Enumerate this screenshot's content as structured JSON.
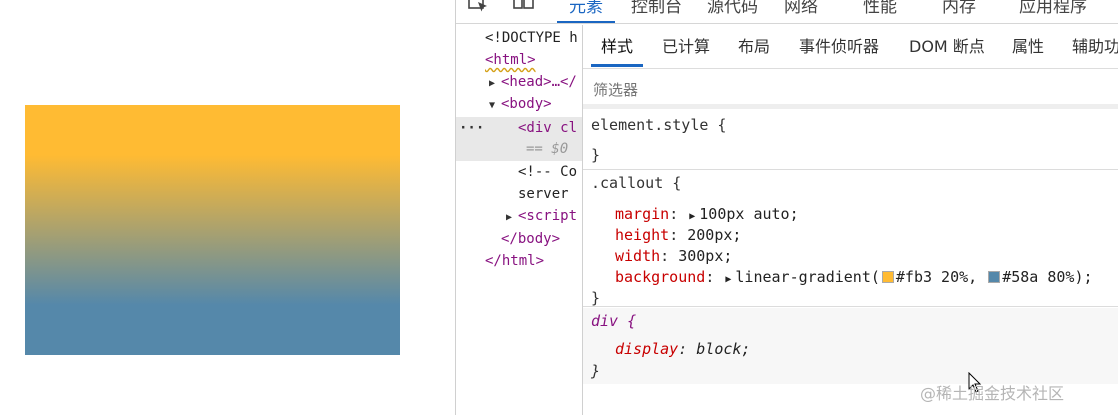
{
  "devtools": {
    "main_tabs": [
      "元素",
      "控制台",
      "源代码",
      "网络",
      "性能",
      "内存",
      "应用程序"
    ],
    "sub_tabs": [
      "样式",
      "已计算",
      "布局",
      "事件侦听器",
      "DOM 断点",
      "属性",
      "辅助功"
    ],
    "filter_placeholder": "筛选器",
    "dom_tree": {
      "doctype": "<!DOCTYPE h",
      "html_open": "<html>",
      "head": "<head>…</",
      "body_open": "<body>",
      "ellipsis": "···",
      "div": "<div cl",
      "eq": "== $0",
      "comment": "<!-- Co",
      "server": "server",
      "script": "<script",
      "body_close": "</body>",
      "html_close": "</html>"
    },
    "rules": {
      "element_style_selector": "element.style {",
      "close_brace": "}",
      "callout_selector": ".callout {",
      "margin_name": "margin",
      "margin_value": "100px auto;",
      "height_name": "height",
      "height_value": "200px;",
      "width_name": "width",
      "width_value": "300px;",
      "background_name": "background",
      "bg_func": "linear-gradient(",
      "bg_stop1": "#fb3 20%,",
      "bg_stop2": "#58a 80%);",
      "div_selector": "div {",
      "display_name": "display",
      "display_value": "block;",
      "colon": ":"
    },
    "swatch_colors": [
      "#ffbb33",
      "#5588aa"
    ]
  },
  "watermark": "@稀土掘金技术社区"
}
